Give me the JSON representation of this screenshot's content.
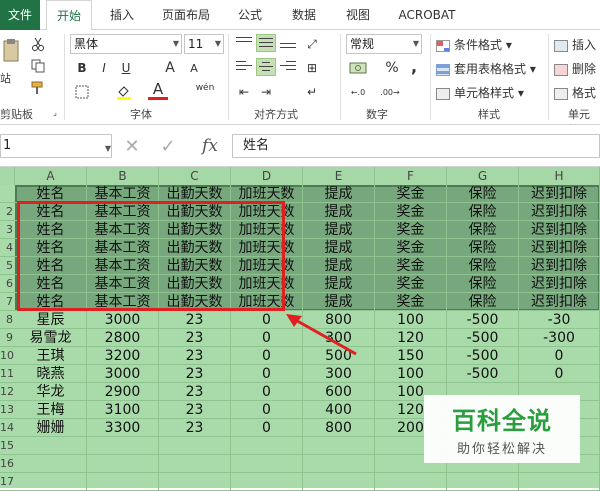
{
  "tabs": [
    "文件",
    "开始",
    "插入",
    "页面布局",
    "公式",
    "数据",
    "视图",
    "ACROBAT"
  ],
  "active_tab": "开始",
  "ribbon": {
    "clipboard": {
      "label": "剪贴板",
      "paste_fragment": "站",
      "paste_fragment2": "粘"
    },
    "font": {
      "label": "字体",
      "font_name": "黑体",
      "font_size": "11",
      "bold": "B",
      "italic": "I",
      "underline": "U",
      "grow": "A",
      "shrink": "A",
      "color_a": "A",
      "wen": "wén"
    },
    "alignment": {
      "label": "对齐方式"
    },
    "number": {
      "label": "数字",
      "format": "常规",
      "percent": "%",
      "comma": ","
    },
    "styles": {
      "label": "样式",
      "conditional": "条件格式",
      "table_format": "套用表格格式",
      "cell_style": "单元格样式"
    },
    "cells": {
      "label": "单元格",
      "insert": "插入",
      "delete": "删除",
      "format": "格式"
    }
  },
  "formula_bar": {
    "name_box": "1",
    "fx": "fx",
    "content": "姓名"
  },
  "columns": [
    "A",
    "B",
    "C",
    "D",
    "E",
    "F",
    "G",
    "H"
  ],
  "rows": [
    {
      "num": "",
      "cells": [
        "姓名",
        "基本工资",
        "出勤天数",
        "加班天数",
        "提成",
        "奖金",
        "保险",
        "迟到扣除"
      ]
    },
    {
      "num": "2",
      "cells": [
        "姓名",
        "基本工资",
        "出勤天数",
        "加班天数",
        "提成",
        "奖金",
        "保险",
        "迟到扣除"
      ]
    },
    {
      "num": "3",
      "cells": [
        "姓名",
        "基本工资",
        "出勤天数",
        "加班天数",
        "提成",
        "奖金",
        "保险",
        "迟到扣除"
      ]
    },
    {
      "num": "4",
      "cells": [
        "姓名",
        "基本工资",
        "出勤天数",
        "加班天数",
        "提成",
        "奖金",
        "保险",
        "迟到扣除"
      ]
    },
    {
      "num": "5",
      "cells": [
        "姓名",
        "基本工资",
        "出勤天数",
        "加班天数",
        "提成",
        "奖金",
        "保险",
        "迟到扣除"
      ]
    },
    {
      "num": "6",
      "cells": [
        "姓名",
        "基本工资",
        "出勤天数",
        "加班天数",
        "提成",
        "奖金",
        "保险",
        "迟到扣除"
      ]
    },
    {
      "num": "7",
      "cells": [
        "姓名",
        "基本工资",
        "出勤天数",
        "加班天数",
        "提成",
        "奖金",
        "保险",
        "迟到扣除"
      ]
    },
    {
      "num": "8",
      "cells": [
        "星辰",
        "3000",
        "23",
        "0",
        "800",
        "100",
        "-500",
        "-30"
      ]
    },
    {
      "num": "9",
      "cells": [
        "易雪龙",
        "2800",
        "23",
        "0",
        "300",
        "120",
        "-500",
        "-300"
      ]
    },
    {
      "num": "10",
      "cells": [
        "王琪",
        "3200",
        "23",
        "0",
        "500",
        "150",
        "-500",
        "0"
      ]
    },
    {
      "num": "11",
      "cells": [
        "晓燕",
        "3000",
        "23",
        "0",
        "300",
        "100",
        "-500",
        "0"
      ]
    },
    {
      "num": "12",
      "cells": [
        "华龙",
        "2900",
        "23",
        "0",
        "600",
        "100",
        "",
        ""
      ]
    },
    {
      "num": "13",
      "cells": [
        "王梅",
        "3100",
        "23",
        "0",
        "400",
        "120",
        "",
        ""
      ]
    },
    {
      "num": "14",
      "cells": [
        "姗姗",
        "3300",
        "23",
        "0",
        "800",
        "200",
        "",
        ""
      ]
    },
    {
      "num": "15",
      "cells": [
        "",
        "",
        "",
        "",
        "",
        "",
        "",
        ""
      ]
    },
    {
      "num": "16",
      "cells": [
        "",
        "",
        "",
        "",
        "",
        "",
        "",
        ""
      ]
    },
    {
      "num": "17",
      "cells": [
        "",
        "",
        "",
        "",
        "",
        "",
        "",
        ""
      ]
    }
  ],
  "watermark": {
    "title": "百科全说",
    "subtitle": "助你轻松解决"
  },
  "colors": {
    "excel_green": "#217346",
    "sheet_bg": "#a9dbaa",
    "selection": "#6f9e76",
    "annotation_red": "#e02020"
  }
}
